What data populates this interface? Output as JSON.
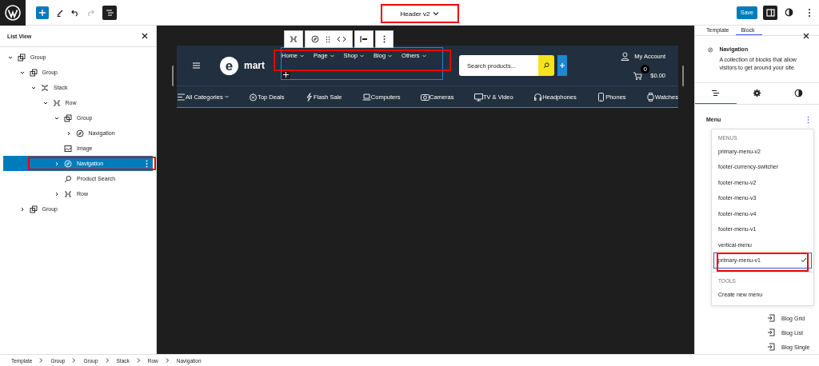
{
  "topbar": {
    "title": "Header v2",
    "title_highlighted": true,
    "redo_disabled": true,
    "list_view_on": true,
    "save": "Save",
    "settings_on": true
  },
  "list_view": {
    "title": "List View",
    "items": [
      {
        "label": "Group",
        "kind": "group",
        "expanded": true,
        "selected": false,
        "highlighted": false,
        "children": [
          {
            "label": "Group",
            "kind": "group",
            "expanded": true,
            "selected": false,
            "highlighted": false,
            "children": [
              {
                "label": "Stack",
                "kind": "stack",
                "expanded": true,
                "selected": false,
                "highlighted": false,
                "children": [
                  {
                    "label": "Row",
                    "kind": "row",
                    "expanded": true,
                    "selected": false,
                    "highlighted": false,
                    "children": [
                      {
                        "label": "Group",
                        "kind": "group",
                        "expanded": true,
                        "selected": false,
                        "highlighted": false,
                        "children": [
                          {
                            "label": "Navigation",
                            "kind": "navigation",
                            "expanded": false,
                            "selected": false,
                            "highlighted": false
                          }
                        ]
                      },
                      {
                        "label": "Image",
                        "kind": "image",
                        "selected": false,
                        "highlighted": false
                      },
                      {
                        "label": "Navigation",
                        "kind": "navigation",
                        "expanded": false,
                        "selected": true,
                        "highlighted": true
                      },
                      {
                        "label": "Product Search",
                        "kind": "search",
                        "selected": false,
                        "highlighted": false
                      },
                      {
                        "label": "Row",
                        "kind": "row",
                        "expanded": false,
                        "selected": false,
                        "highlighted": false
                      }
                    ]
                  }
                ]
              }
            ]
          },
          {
            "label": "Group",
            "kind": "group",
            "expanded": false,
            "selected": false,
            "highlighted": false
          }
        ]
      }
    ]
  },
  "canvas": {
    "header": {
      "logo_mark": "e",
      "logo_text": "mart",
      "nav": [
        {
          "label": "Home"
        },
        {
          "label": "Page"
        },
        {
          "label": "Shop"
        },
        {
          "label": "Blog"
        },
        {
          "label": "Others"
        }
      ],
      "nav_highlighted": true,
      "search": {
        "placeholder": "Search products..."
      },
      "account": "My Account",
      "cart_count": "0",
      "cart_total": "$0.00",
      "categories": [
        {
          "label": "All Categories",
          "kind": "menu"
        },
        {
          "label": "Top Deals",
          "kind": "timer"
        },
        {
          "label": "Flash Sale",
          "kind": "flash"
        },
        {
          "label": "Computers",
          "kind": "laptop"
        },
        {
          "label": "Cameras",
          "kind": "camera"
        },
        {
          "label": "TV & Video",
          "kind": "tv"
        },
        {
          "label": "Headphones",
          "kind": "headphones"
        },
        {
          "label": "Phones",
          "kind": "phone"
        },
        {
          "label": "Watches",
          "kind": "watch"
        }
      ]
    }
  },
  "inspector": {
    "tabs": [
      {
        "label": "Template",
        "selected": false
      },
      {
        "label": "Block",
        "selected": true
      }
    ],
    "block": {
      "name": "Navigation",
      "description": "A collection of blocks that allow visitors to get around your site."
    },
    "subtabs": [
      {
        "kind": "list",
        "selected": true
      },
      {
        "kind": "settings",
        "selected": false
      },
      {
        "kind": "styles",
        "selected": false
      }
    ],
    "menu_label": "Menu",
    "dropdown": [
      {
        "heading": "MENUS",
        "items": [
          {
            "label": "primary-menu-v2",
            "selected": false,
            "highlighted": false
          },
          {
            "label": "footer-currency-switcher",
            "selected": false,
            "highlighted": false
          },
          {
            "label": "footer-menu-v2",
            "selected": false,
            "highlighted": false
          },
          {
            "label": "footer-menu-v3",
            "selected": false,
            "highlighted": false
          },
          {
            "label": "footer-menu-v4",
            "selected": false,
            "highlighted": false
          },
          {
            "label": "footer-menu-v1",
            "selected": false,
            "highlighted": false
          },
          {
            "label": "vertical-menu",
            "selected": false,
            "highlighted": false
          },
          {
            "label": "primary-menu-v1",
            "selected": true,
            "highlighted": true
          }
        ]
      },
      {
        "heading": "TOOLS",
        "items": [
          {
            "label": "Create new menu",
            "selected": false,
            "highlighted": false
          }
        ]
      }
    ],
    "patterns": [
      "Blog Grid",
      "Blog List",
      "Blog Single"
    ]
  },
  "breadcrumb": [
    "Template",
    "Group",
    "Group",
    "Stack",
    "Row",
    "Navigation"
  ]
}
